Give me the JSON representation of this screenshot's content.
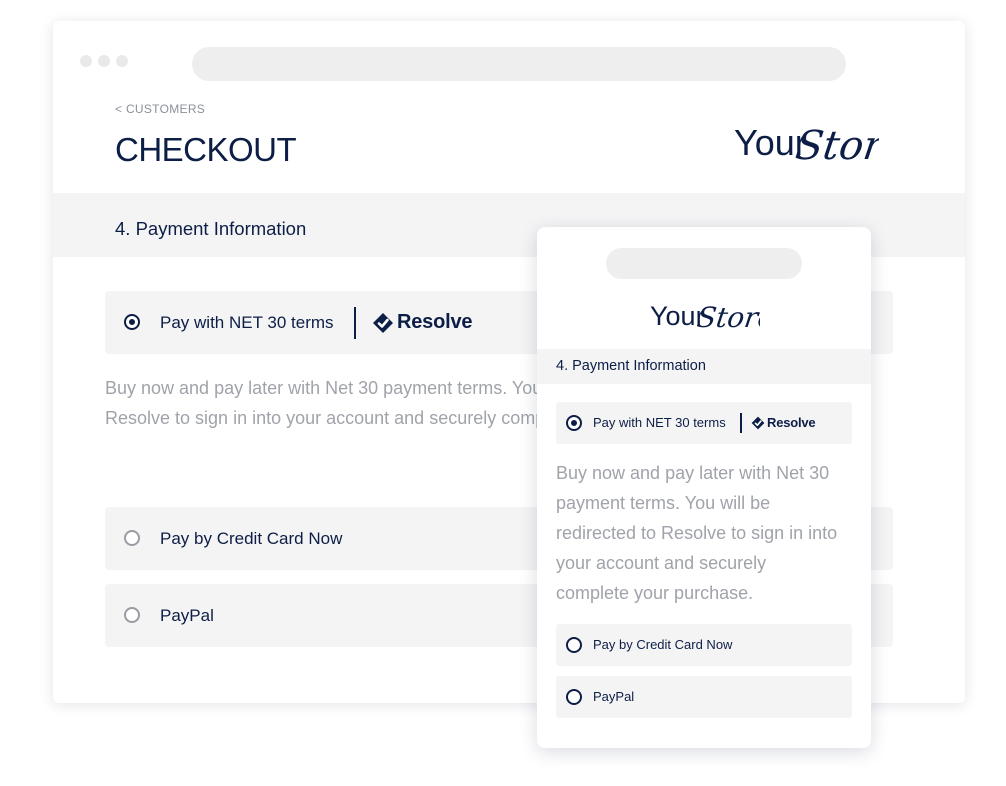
{
  "header": {
    "breadcrumb": "< CUSTOMERS",
    "title": "CHECKOUT",
    "logo_text_plain": "Your",
    "logo_text_script": "Store"
  },
  "payment": {
    "section_title": "4.  Payment Information",
    "net30": {
      "label": "Pay with NET 30 terms",
      "brand": "Resolve",
      "selected": true,
      "description_lines": [
        "Buy now and pay later with Net 30 payment terms. You will be redirected to",
        "Resolve to sign in into your account and securely complete your purchase."
      ]
    },
    "credit_card": {
      "label": "Pay by Credit Card Now",
      "selected": false
    },
    "paypal": {
      "label": "PayPal",
      "selected": false
    }
  },
  "mobile": {
    "logo_text_plain": "Your",
    "logo_text_script": "Store",
    "section_title": "4.  Payment Information",
    "net30_label": "Pay with NET 30 terms",
    "brand": "Resolve",
    "description_lines": [
      "Buy now and pay later with Net 30",
      "payment terms. You will be",
      "redirected to Resolve to sign in into",
      "your account and securely",
      "complete your purchase."
    ],
    "credit_card_label": "Pay by Credit Card Now",
    "paypal_label": "PayPal"
  },
  "colors": {
    "navy": "#0d1e46",
    "muted_text": "#a0a3aa",
    "panel_gray": "#f4f4f5"
  },
  "icons": [
    "window-dots",
    "resolve-logo-icon",
    "radio-selected-icon",
    "radio-empty-icon"
  ]
}
